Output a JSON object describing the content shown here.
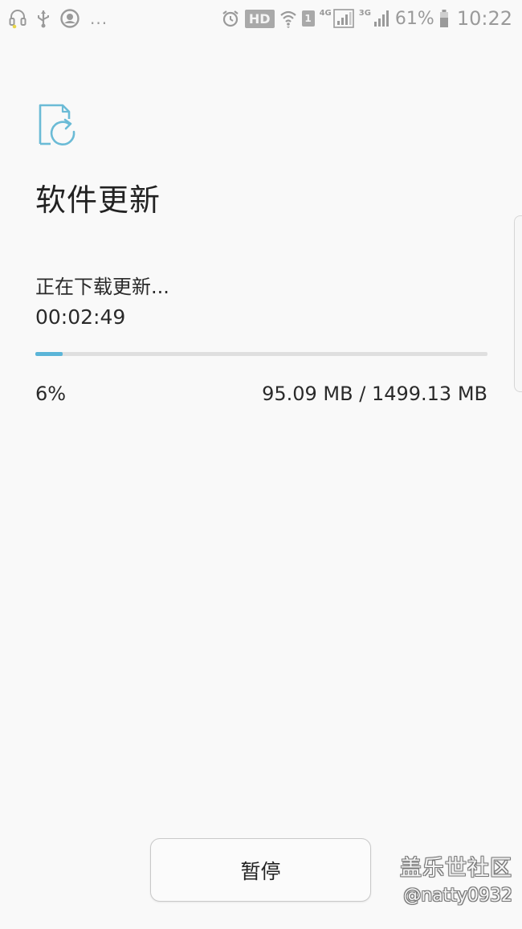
{
  "status_bar": {
    "left_icons": [
      "headset-icon",
      "usb-icon",
      "chat-bubble-icon"
    ],
    "more_indicator": "...",
    "hd_badge": "HD",
    "sim_badge": "1",
    "network_4g": "4G",
    "network_3g": "3G",
    "battery_percent": "61%",
    "time": "10:22"
  },
  "header": {
    "icon": "software-update-icon",
    "title": "软件更新"
  },
  "download": {
    "status": "正在下载更新...",
    "elapsed": "00:02:49",
    "progress_percent": 6,
    "percent_label": "6%",
    "size_label": "95.09 MB / 1499.13 MB"
  },
  "footer": {
    "pause_button": "暂停"
  },
  "watermark": {
    "line1": "盖乐世社区",
    "line2": "@natty0932"
  },
  "colors": {
    "background": "#f9f9f9",
    "accent": "#5bb5d8",
    "progress_track": "#dfdfdf",
    "text": "#222222",
    "status_icons": "#9a9a9a"
  }
}
